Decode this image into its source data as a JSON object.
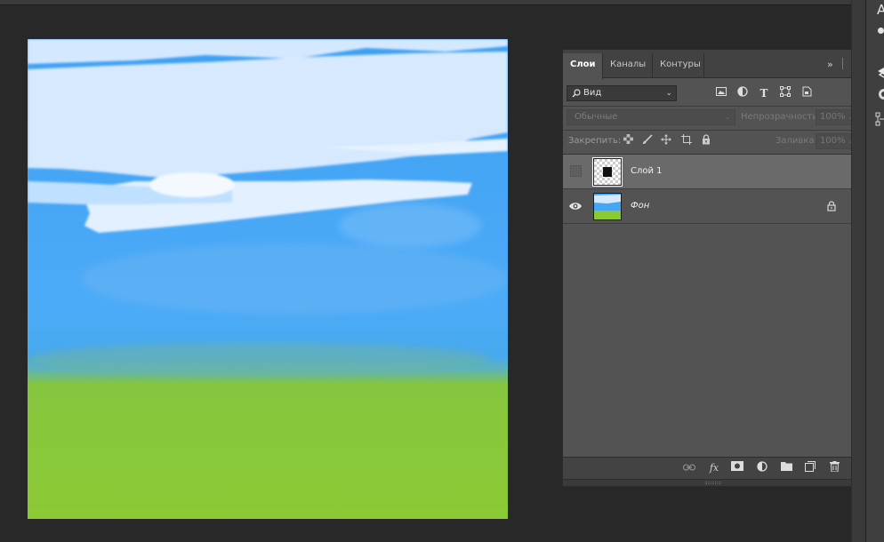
{
  "layers_panel": {
    "tabs": [
      {
        "label": "Слои",
        "active": true
      },
      {
        "label": "Каналы",
        "active": false
      },
      {
        "label": "Контуры",
        "active": false
      }
    ],
    "tab_controls": {
      "collapse": "»",
      "menu": "≡"
    },
    "filter": {
      "value": "Вид"
    },
    "blend_mode": {
      "value": "Обычные"
    },
    "opacity": {
      "label": "Непрозрачность:",
      "value": "100%"
    },
    "lock": {
      "label": "Закрепить:"
    },
    "fill": {
      "label": "Заливка:",
      "value": "100%"
    },
    "layers": [
      {
        "name": "Слой 1",
        "visible": false,
        "selected": true,
        "locked": false
      },
      {
        "name": "Фон",
        "visible": true,
        "selected": false,
        "locked": true
      }
    ]
  },
  "right_strip": {
    "letter": "A"
  },
  "colors": {
    "workspace": "#282828",
    "panel": "#535353",
    "selected_layer": "#6a6a6a",
    "sky": "#45a6f5",
    "grass": "#8bc934",
    "cloud": "#d6e9ff"
  }
}
